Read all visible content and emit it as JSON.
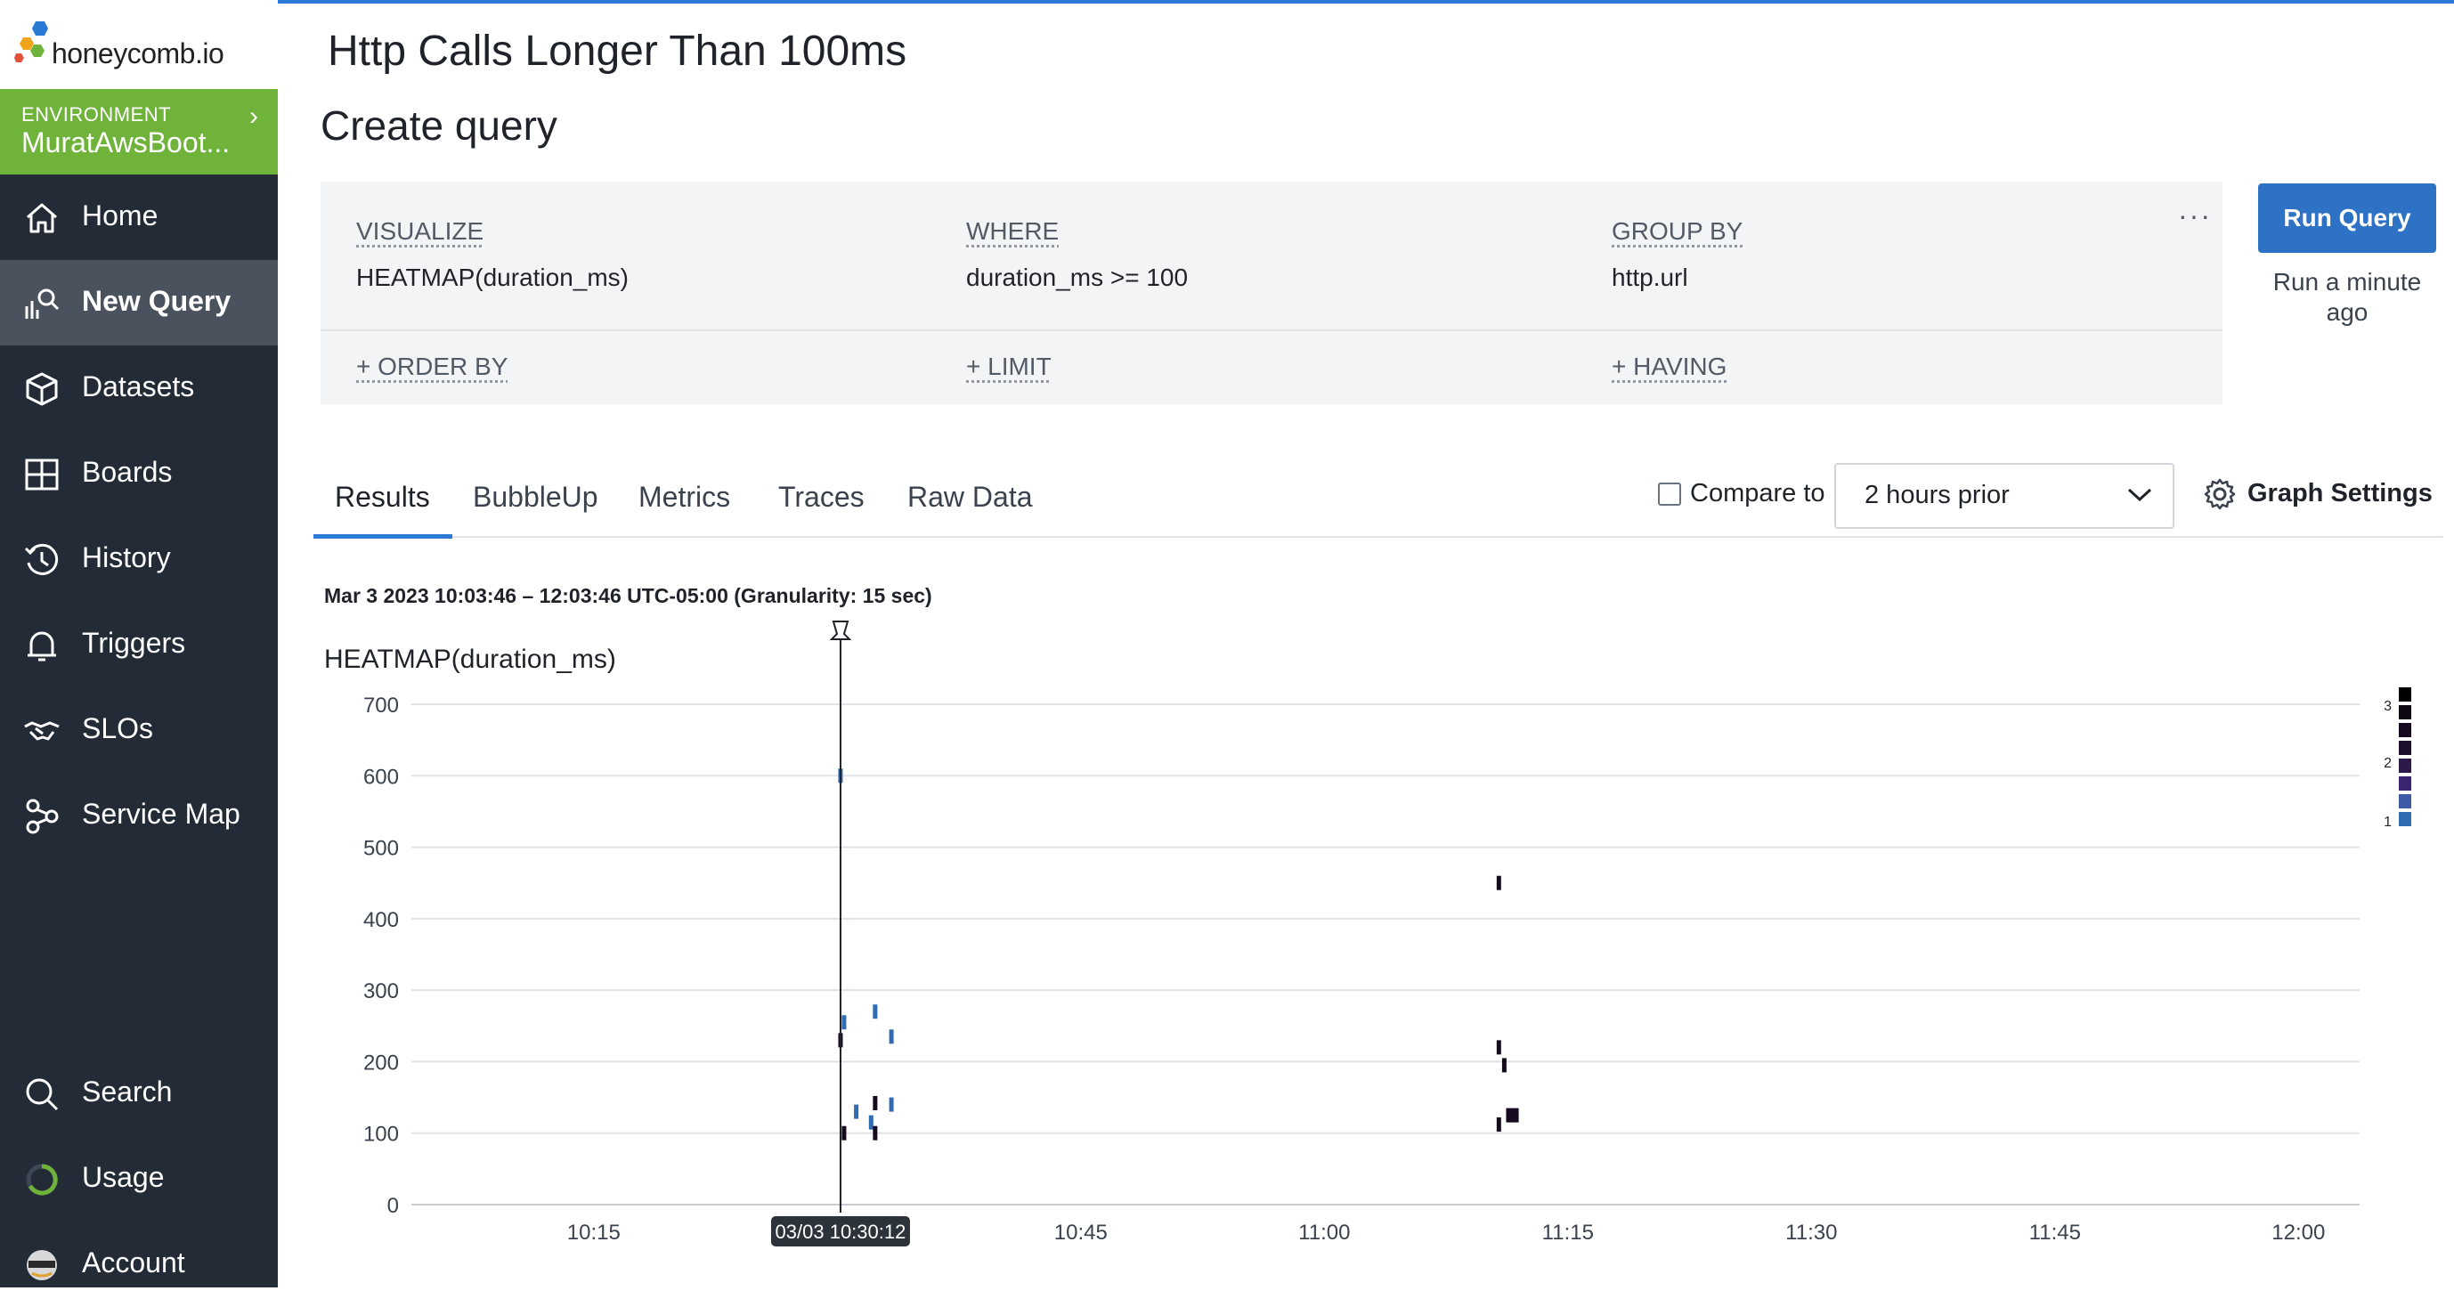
{
  "app": {
    "logo_text": "honeycomb.io"
  },
  "environment": {
    "label": "ENVIRONMENT",
    "name": "MuratAwsBoot..."
  },
  "sidebar": {
    "items": [
      {
        "label": "Home",
        "icon": "home-icon"
      },
      {
        "label": "New Query",
        "icon": "query-icon",
        "active": true
      },
      {
        "label": "Datasets",
        "icon": "dataset-cube-icon"
      },
      {
        "label": "Boards",
        "icon": "boards-grid-icon"
      },
      {
        "label": "History",
        "icon": "history-clock-icon"
      },
      {
        "label": "Triggers",
        "icon": "bell-icon"
      },
      {
        "label": "SLOs",
        "icon": "handshake-icon"
      },
      {
        "label": "Service Map",
        "icon": "service-map-icon"
      },
      {
        "label": "Search",
        "icon": "search-icon"
      },
      {
        "label": "Usage",
        "icon": "usage-ring-icon"
      },
      {
        "label": "Account",
        "icon": "account-avatar-icon"
      }
    ]
  },
  "page": {
    "title": "Http Calls Longer Than 100ms",
    "subtitle": "Create query"
  },
  "query": {
    "visualize": {
      "label": "VISUALIZE",
      "value": "HEATMAP(duration_ms)"
    },
    "where": {
      "label": "WHERE",
      "value": "duration_ms >= 100"
    },
    "group_by": {
      "label": "GROUP BY",
      "value": "http.url"
    },
    "order_by": "+ ORDER BY",
    "limit": "+ LIMIT",
    "having": "+ HAVING",
    "more": "···"
  },
  "run": {
    "button": "Run Query",
    "last_run": "Run a minute ago"
  },
  "tabs": [
    {
      "label": "Results",
      "active": true
    },
    {
      "label": "BubbleUp"
    },
    {
      "label": "Metrics"
    },
    {
      "label": "Traces"
    },
    {
      "label": "Raw Data"
    }
  ],
  "compare": {
    "label": "Compare to",
    "checked": false,
    "selected": "2 hours prior"
  },
  "graph_settings": {
    "label": "Graph Settings"
  },
  "chart": {
    "range_text": "Mar 3 2023 10:03:46 – 12:03:46 UTC-05:00 (Granularity: 15 sec)",
    "marker_label": "03/03 10:30:12"
  },
  "colors": {
    "accent": "#2b7bd6",
    "env": "#6fb33b",
    "sidebar": "#232b37",
    "run_button": "#2d72c4"
  },
  "chart_data": {
    "type": "heatmap",
    "title": "HEATMAP(duration_ms)",
    "xlabel": "",
    "ylabel": "",
    "ylim": [
      0,
      700
    ],
    "y_ticks": [
      0,
      100,
      200,
      300,
      400,
      500,
      600,
      700
    ],
    "x_ticks": [
      "10:15",
      "10:30",
      "10:45",
      "11:00",
      "11:15",
      "11:30",
      "11:45",
      "12:00"
    ],
    "grid": true,
    "legend": {
      "placement": "right",
      "labels": [
        1,
        2,
        3
      ]
    },
    "cells": [
      {
        "t": "10:30:12",
        "y": 600,
        "count": 1
      },
      {
        "t": "10:30:12",
        "y": 230,
        "count": 3
      },
      {
        "t": "10:30:25",
        "y": 255,
        "count": 1
      },
      {
        "t": "10:30:25",
        "y": 100,
        "count": 3
      },
      {
        "t": "10:31:10",
        "y": 130,
        "count": 1
      },
      {
        "t": "10:32:05",
        "y": 115,
        "count": 1
      },
      {
        "t": "10:32:20",
        "y": 270,
        "count": 1
      },
      {
        "t": "10:32:20",
        "y": 142,
        "count": 3
      },
      {
        "t": "10:32:20",
        "y": 100,
        "count": 3
      },
      {
        "t": "10:33:20",
        "y": 235,
        "count": 1
      },
      {
        "t": "10:33:20",
        "y": 140,
        "count": 1
      },
      {
        "t": "11:10:45",
        "y": 450,
        "count": 3
      },
      {
        "t": "11:10:45",
        "y": 220,
        "count": 3
      },
      {
        "t": "11:10:45",
        "y": 112,
        "count": 3
      },
      {
        "t": "11:11:05",
        "y": 195,
        "count": 3
      },
      {
        "t": "11:11:20",
        "y": 125,
        "count": 3
      },
      {
        "t": "11:11:35",
        "y": 125,
        "count": 3
      },
      {
        "t": "11:11:50",
        "y": 125,
        "count": 3
      }
    ]
  }
}
